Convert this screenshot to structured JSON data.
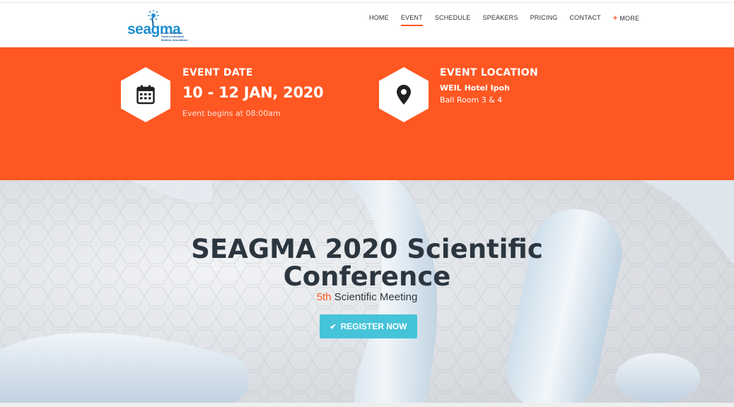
{
  "logo": {
    "text": "seagma",
    "subtitle": "South East Asia Gastro-intestinal Motility Association",
    "icon": "seahorse-logo-icon"
  },
  "nav": {
    "items": [
      {
        "label": "HOME",
        "active": false
      },
      {
        "label": "EVENT",
        "active": true
      },
      {
        "label": "SCHEDULE",
        "active": false
      },
      {
        "label": "SPEAKERS",
        "active": false
      },
      {
        "label": "PRICING",
        "active": false
      },
      {
        "label": "CONTACT",
        "active": false
      }
    ],
    "more_plus": "+",
    "more_label": "MORE"
  },
  "event_date": {
    "icon": "calendar-icon",
    "title": "EVENT DATE",
    "date": "10 - 12 JAN, 2020",
    "note": "Event begins at 08:00am"
  },
  "event_location": {
    "icon": "map-marker-icon",
    "title": "EVENT LOCATION",
    "venue": "WEIL Hotel Ipoh",
    "room": "Ball Room 3 & 4"
  },
  "hero": {
    "title_line1": "SEAGMA 2020 Scientific",
    "title_line2": "Conference",
    "sub_accent": "5th",
    "sub_rest": " Scientific Meeting",
    "register_icon": "check-icon",
    "register_label": "REGISTER NOW"
  },
  "colors": {
    "accent": "#ff5722",
    "button": "#45c3d8",
    "heading": "#2c3640",
    "logo_blue": "#1f8fce"
  }
}
